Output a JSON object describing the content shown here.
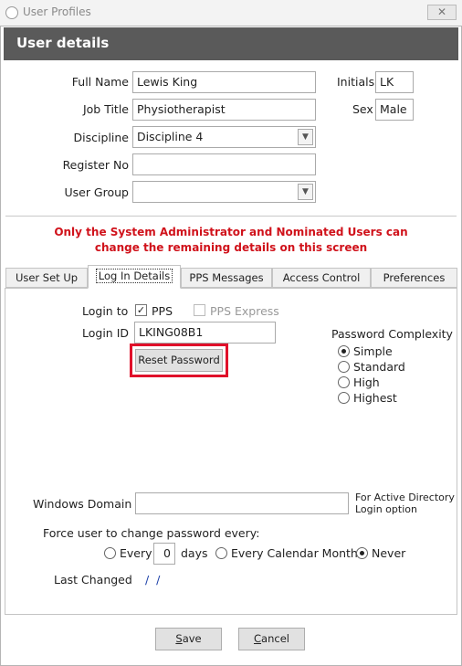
{
  "window": {
    "title": "User Profiles",
    "close": "✕"
  },
  "header": {
    "title": "User details"
  },
  "form": {
    "full_name_label": "Full Name",
    "full_name": "Lewis King",
    "job_title_label": "Job Title",
    "job_title": "Physiotherapist",
    "discipline_label": "Discipline",
    "discipline": "Discipline 4",
    "register_no_label": "Register No",
    "register_no": "",
    "user_group_label": "User Group",
    "user_group": "",
    "initials_label": "Initials",
    "initials": "LK",
    "sex_label": "Sex",
    "sex": "Male"
  },
  "notice": {
    "line1": "Only the System Administrator and Nominated Users can",
    "line2": "change the remaining details on this screen"
  },
  "tabs": [
    {
      "label": "User Set Up"
    },
    {
      "label": "Log In Details"
    },
    {
      "label": "PPS Messages"
    },
    {
      "label": "Access Control"
    },
    {
      "label": "Preferences"
    }
  ],
  "login": {
    "login_to_label": "Login to",
    "pps_label": "PPS",
    "pps_checked_mark": "✓",
    "pps_express_label": "PPS Express",
    "login_id_label": "Login ID",
    "login_id": "LKING08B1",
    "reset_password": "Reset Password"
  },
  "complexity": {
    "title": "Password Complexity",
    "options": [
      "Simple",
      "Standard",
      "High",
      "Highest"
    ],
    "selected": "Simple"
  },
  "windows_domain": {
    "label": "Windows Domain",
    "value": "",
    "note_line1": "For Active Directory",
    "note_line2": "Login option"
  },
  "force_change": {
    "label": "Force user to change password every:",
    "every": "Every",
    "days_value": "0",
    "days": "days",
    "calendar_month": "Every Calendar Month",
    "never": "Never",
    "selected": "Never"
  },
  "last_changed": {
    "label": "Last Changed",
    "value": "/ /"
  },
  "footer": {
    "save_u": "S",
    "save_rest": "ave",
    "cancel_u": "C",
    "cancel_rest": "ancel"
  }
}
